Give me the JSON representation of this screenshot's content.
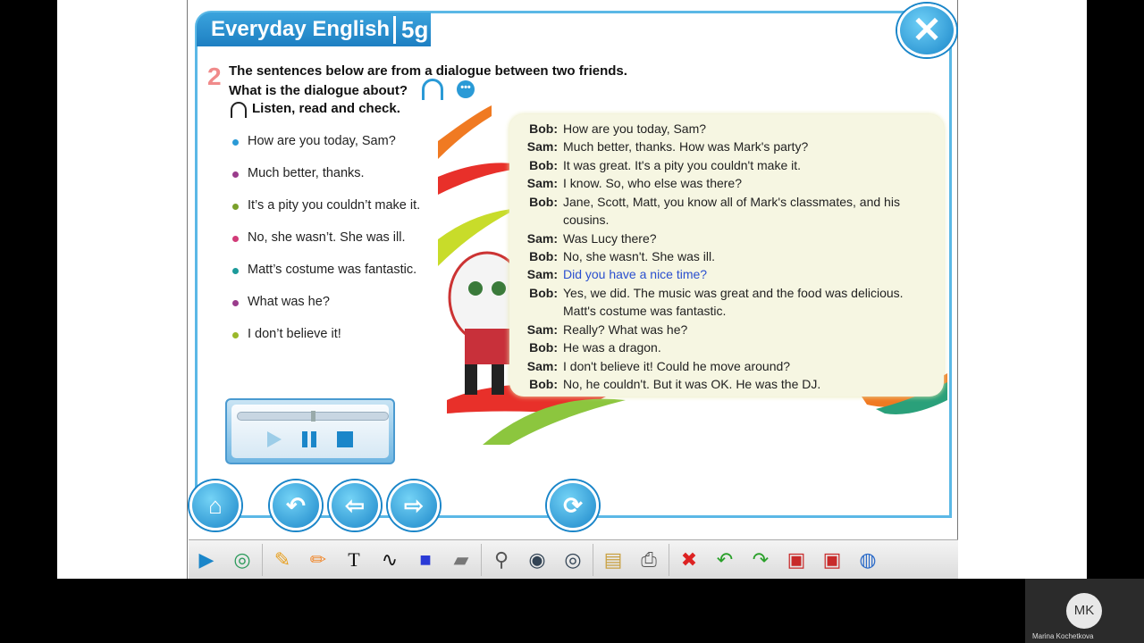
{
  "header": {
    "title": "Everyday English",
    "unit": "5g"
  },
  "close_symbol": "✕",
  "task": {
    "number": "2",
    "line1": "The sentences below are from a dialogue between two friends.",
    "line2": "What is the dialogue about?",
    "listen": "Listen, read and check."
  },
  "sentences": [
    {
      "text": "How are you today, Sam?",
      "color": "#2a9ad6"
    },
    {
      "text": "Much better, thanks.",
      "color": "#9a3c8c"
    },
    {
      "text": "It’s a pity you couldn’t make it.",
      "color": "#7aa02a"
    },
    {
      "text": "No, she wasn’t. She was ill.",
      "color": "#d23b78"
    },
    {
      "text": "Matt’s costume was fantastic.",
      "color": "#1c9a9a"
    },
    {
      "text": "What was he?",
      "color": "#9a3c8c"
    },
    {
      "text": "I don’t believe it!",
      "color": "#9ab82a"
    }
  ],
  "dialogue": [
    {
      "who": "Bob:",
      "text": "How are you today, Sam?"
    },
    {
      "who": "Sam:",
      "text": "Much better, thanks. How was Mark's party?"
    },
    {
      "who": "Bob:",
      "text": "It was great. It's a pity you couldn't make it."
    },
    {
      "who": "Sam:",
      "text": "I know. So, who else was there?"
    },
    {
      "who": "Bob:",
      "text": "Jane, Scott, Matt, you know all of Mark's classmates, and his cousins."
    },
    {
      "who": "Sam:",
      "text": "Was Lucy there?"
    },
    {
      "who": "Bob:",
      "text": "No, she wasn't. She was ill."
    },
    {
      "who": "Sam:",
      "text": "Did you have a nice time?"
    },
    {
      "who": "Bob:",
      "text": "Yes, we did. The music was great and the food was delicious. Matt's costume was fantastic."
    },
    {
      "who": "Sam:",
      "text": "Really? What was he?"
    },
    {
      "who": "Bob:",
      "text": "He was a dragon."
    },
    {
      "who": "Sam:",
      "text": "I don't believe it! Could he move around?"
    },
    {
      "who": "Bob:",
      "text": "No, he couldn't. But it was OK. He was the DJ."
    }
  ],
  "player": {
    "progress": 0.5
  },
  "nav_icons": [
    "home-icon",
    "back-icon",
    "previous-icon",
    "next-icon",
    "refresh-icon"
  ],
  "toolbar_icons": [
    "expand-icon",
    "lasso-icon",
    "pen-icon",
    "highlighter-icon",
    "text-icon",
    "freehand-icon",
    "shape-icon",
    "eraser-icon",
    "zoom-icon",
    "reveal-icon",
    "hide-icon",
    "notes-icon",
    "print-icon",
    "clear-icon",
    "undo-icon",
    "redo-icon",
    "save-icon",
    "save-as-icon",
    "globe-icon"
  ],
  "user": {
    "initials": "MK",
    "name": "Marina Kochetkova"
  }
}
